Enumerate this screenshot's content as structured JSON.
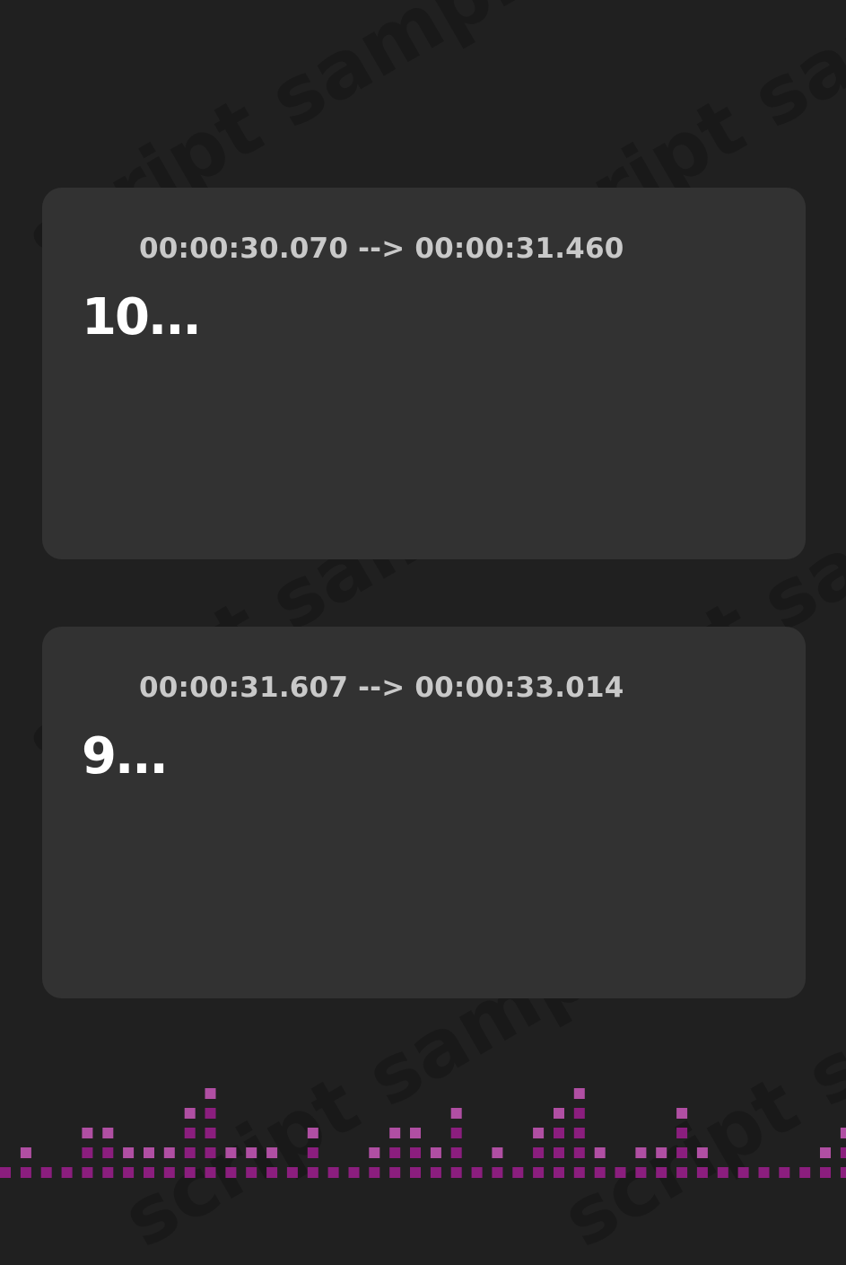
{
  "watermark": {
    "text": "script sample"
  },
  "colors": {
    "background": "#202020",
    "card": "#323232",
    "accent": "#cc44cc",
    "equalizer": "#8b1e7e",
    "equalizer_peak": "#b04fa3"
  },
  "cards": [
    {
      "icon": "audio-wave-icon",
      "timestamp": "00:00:30.070 --> 00:00:31.460",
      "caption": "10..."
    },
    {
      "icon": "audio-wave-icon",
      "timestamp": "00:00:31.607 --> 00:00:33.014",
      "caption": "9..."
    }
  ],
  "equalizer": {
    "icon": "equalizer-bars",
    "levels": [
      1,
      2,
      1,
      1,
      3,
      3,
      2,
      2,
      2,
      4,
      5,
      2,
      2,
      2,
      1,
      3,
      1,
      1,
      2,
      3,
      3,
      2,
      4,
      1,
      2,
      1,
      3,
      4,
      5,
      2,
      1,
      2,
      2,
      4,
      2,
      1,
      1,
      1,
      1,
      1,
      2,
      3,
      4,
      5,
      3,
      2,
      1,
      2,
      4,
      3,
      1,
      1
    ]
  }
}
